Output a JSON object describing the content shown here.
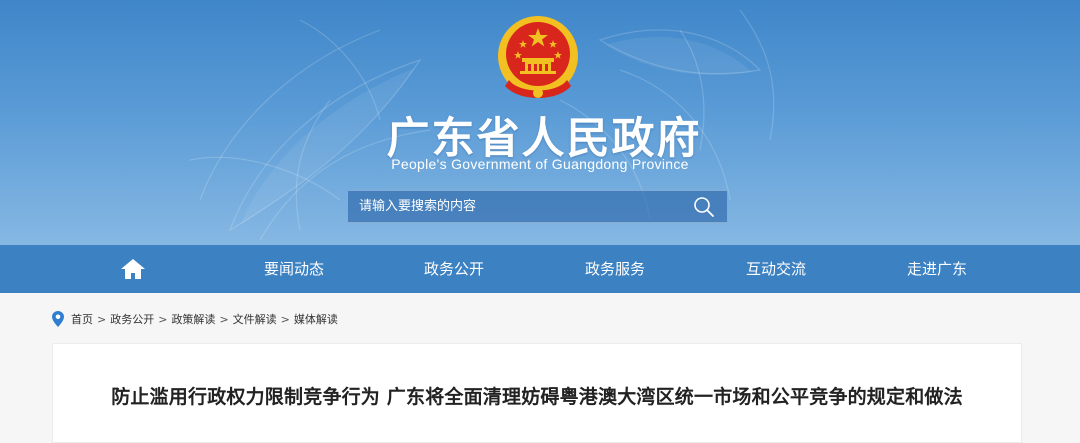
{
  "header": {
    "title": "广东省人民政府",
    "subtitle": "People's Government of Guangdong Province"
  },
  "search": {
    "placeholder": "请输入要搜索的内容"
  },
  "nav": {
    "items": [
      {
        "label": "要闻动态"
      },
      {
        "label": "政务公开"
      },
      {
        "label": "政务服务"
      },
      {
        "label": "互动交流"
      },
      {
        "label": "走进广东"
      }
    ]
  },
  "breadcrumb": {
    "items": [
      "首页",
      "政务公开",
      "政策解读",
      "文件解读",
      "媒体解读"
    ],
    "separator": ">"
  },
  "article": {
    "title": "防止滥用行政权力限制竞争行为 广东将全面清理妨碍粤港澳大湾区统一市场和公平竞争的规定和做法"
  },
  "colors": {
    "banner": "#4a8fd0",
    "navbar": "#3c81c2",
    "emblem_red": "#d8261c",
    "emblem_gold": "#f2c021"
  }
}
